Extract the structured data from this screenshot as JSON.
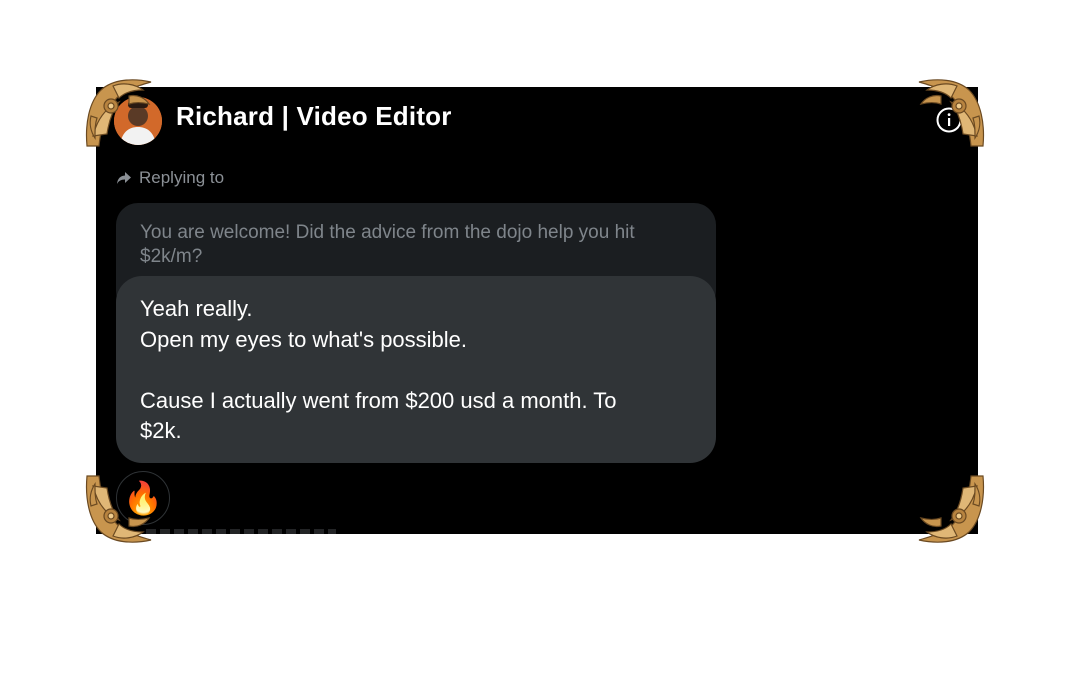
{
  "header": {
    "name": "Richard | Video Editor",
    "avatar_icon": "profile-photo",
    "info_icon": "info-icon"
  },
  "reply": {
    "label": "Replying to",
    "icon": "reply-arrow-icon"
  },
  "quoted_message": {
    "text": "You are welcome! Did the advice from the dojo help you hit\n$2k/m?"
  },
  "message": {
    "text": "Yeah really.\nOpen my eyes to what's possible.\n\nCause I actually went from $200 usd a month. To\n$2k."
  },
  "reaction": {
    "emoji": "🔥",
    "icon": "fire-icon"
  },
  "colors": {
    "panel_bg": "#000000",
    "bubble_bg": "#303437",
    "quoted_bg": "#1b1e21",
    "muted_text": "#8b9096",
    "frame_gold": "#c8954e"
  }
}
